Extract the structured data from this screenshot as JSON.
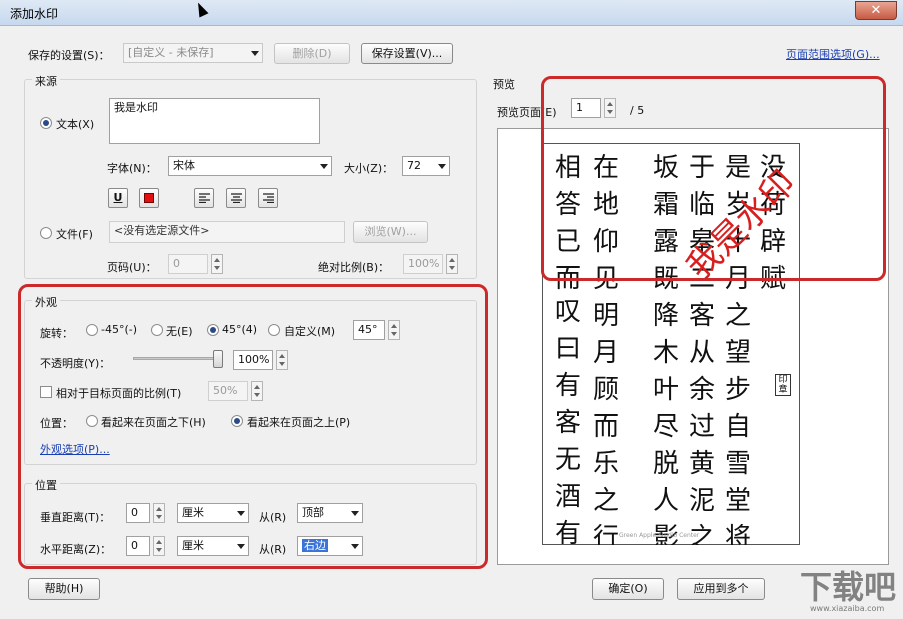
{
  "window": {
    "title": "添加水印",
    "close": "✕"
  },
  "settings": {
    "label": "保存的设置(S)：",
    "value": "[自定义 - 未保存]",
    "delete": "删除(D)",
    "save": "保存设置(V)...",
    "page_range": "页面范围选项(G)..."
  },
  "source": {
    "group": "来源",
    "text_option": "文本(X)",
    "text_value": "我是水印",
    "font_label": "字体(N)：",
    "font_value": "宋体",
    "size_label": "大小(Z)：",
    "size_value": "72",
    "underline": "U",
    "file_option": "文件(F)",
    "file_value": "<没有选定源文件>",
    "browse": "浏览(W)...",
    "page_label": "页码(U)：",
    "page_value": "0",
    "abs_scale_label": "绝对比例(B)：",
    "abs_scale_value": "100%"
  },
  "appearance": {
    "group": "外观",
    "rotation_label": "旋转：",
    "rot_options": [
      "-45°(-)",
      "无(E)",
      "45°(4)",
      "自定义(M)"
    ],
    "rot_selected": "45°(4)",
    "rot_custom_value": "45°",
    "opacity_label": "不透明度(Y)：",
    "opacity_value": "100%",
    "opacity_fraction": 1.0,
    "relative_label": "相对于目标页面的比例(T)",
    "relative_value": "50%",
    "position_label": "位置：",
    "pos_below": "看起来在页面之下(H)",
    "pos_above": "看起来在页面之上(P)",
    "options_link": "外观选项(P)..."
  },
  "position": {
    "group": "位置",
    "vertical_label": "垂直距离(T)：",
    "vertical_value": "0",
    "vertical_unit": "厘米",
    "from_label": "从(R)",
    "vertical_from": "顶部",
    "horizontal_label": "水平距离(Z)：",
    "horizontal_value": "0",
    "horizontal_unit": "厘米",
    "horizontal_from": "右边"
  },
  "preview": {
    "group": "预览",
    "page_label": "预览页面(E)",
    "page_value": "1",
    "page_total": "/ 5",
    "watermark": "我是水印",
    "columns": [
      "没荷辟赋",
      "是岁十月之望步自雪堂将归",
      "于临皋二客从余过黄泥之",
      "坂霜露既降木叶尽脱人影",
      "在地仰见明月顾而乐之行歌",
      "相答已而",
      "叹曰有客无酒有"
    ],
    "footer": "Green Apple Studio Center",
    "seal": "印章"
  },
  "footer": {
    "help": "帮助(H)",
    "ok": "确定(O)",
    "apply": "应用到多个"
  },
  "brand": {
    "text": "下载吧",
    "url_text": "www.xiazaiba.com"
  }
}
